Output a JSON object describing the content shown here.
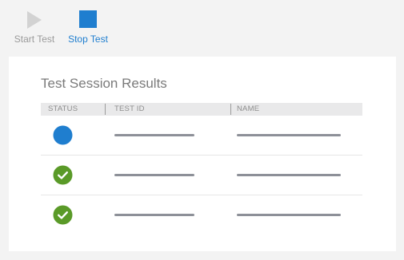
{
  "toolbar": {
    "start_label": "Start Test",
    "stop_label": "Stop Test"
  },
  "panel": {
    "title": "Test Session Results"
  },
  "table": {
    "columns": [
      "STATUS",
      "TEST ID",
      "NAME"
    ],
    "rows": [
      {
        "status": "in-progress",
        "test_id": "",
        "name": ""
      },
      {
        "status": "passed",
        "test_id": "",
        "name": ""
      },
      {
        "status": "passed",
        "test_id": "",
        "name": ""
      }
    ]
  },
  "colors": {
    "accent": "#1f7ecf",
    "running": "#1f7ecf",
    "passed": "#5a9a28",
    "disabled": "#d0d0d0",
    "placeholder": "#8d9098"
  }
}
